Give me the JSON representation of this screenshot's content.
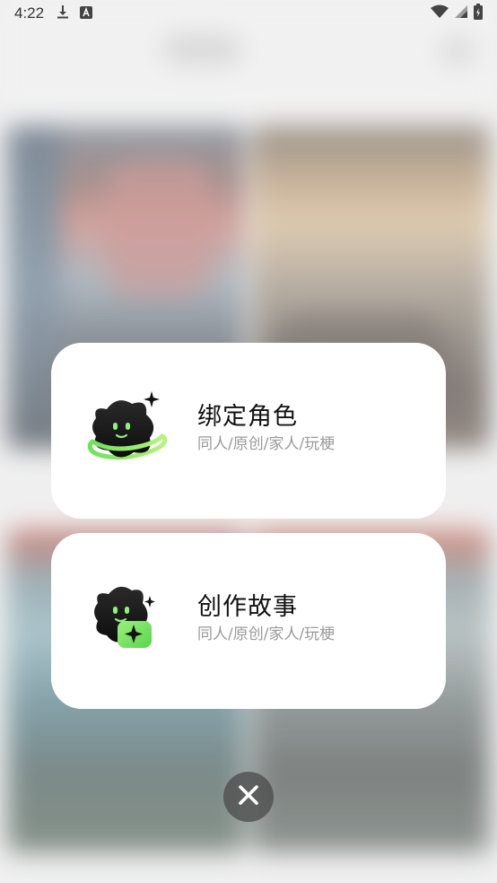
{
  "status_bar": {
    "time": "4:22",
    "icons": [
      "download-icon",
      "keyboard-a-icon",
      "wifi-icon",
      "cell-signal-icon",
      "battery-icon"
    ]
  },
  "options": [
    {
      "title": "绑定角色",
      "subtitle": "同人/原创/家人/玩梗",
      "icon": "star-mascot-orbit-icon"
    },
    {
      "title": "创作故事",
      "subtitle": "同人/原创/家人/玩梗",
      "icon": "star-mascot-sparkle-icon"
    }
  ],
  "close_button": {
    "icon": "close-icon"
  },
  "colors": {
    "accent_green": "#7ee36a",
    "card_bg": "#ffffff",
    "title_text": "#111111",
    "subtitle_text": "#9a9a9a"
  }
}
